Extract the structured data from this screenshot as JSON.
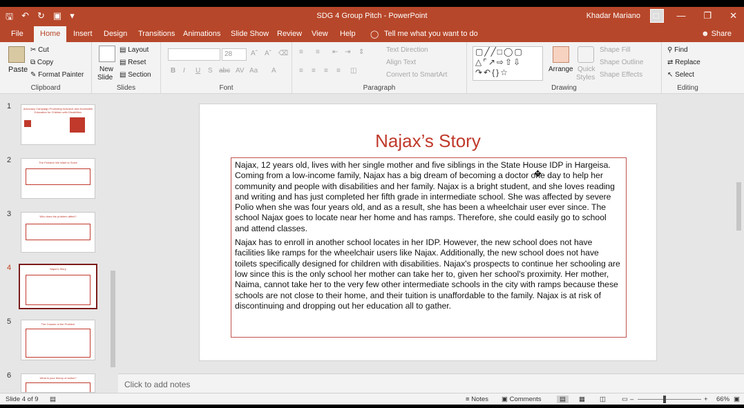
{
  "window": {
    "title": "SDG 4 Group Pitch - PowerPoint",
    "user": "Khadar Mariano"
  },
  "tabs": [
    "File",
    "Home",
    "Insert",
    "Design",
    "Transitions",
    "Animations",
    "Slide Show",
    "Review",
    "View",
    "Help"
  ],
  "tell_me": "Tell me what you want to do",
  "share": "Share",
  "ribbon": {
    "clipboard": {
      "paste": "Paste",
      "cut": "Cut",
      "copy": "Copy",
      "format_painter": "Format Painter",
      "label": "Clipboard"
    },
    "slides": {
      "new_slide_1": "New",
      "new_slide_2": "Slide",
      "layout": "Layout",
      "reset": "Reset",
      "section": "Section",
      "label": "Slides"
    },
    "font": {
      "size": "28",
      "label": "Font"
    },
    "paragraph": {
      "text_direction": "Text Direction",
      "align_text": "Align Text",
      "convert": "Convert to SmartArt",
      "label": "Paragraph"
    },
    "drawing": {
      "arrange": "Arrange",
      "quick_styles_1": "Quick",
      "quick_styles_2": "Styles",
      "shape_fill": "Shape Fill",
      "shape_outline": "Shape Outline",
      "shape_effects": "Shape Effects",
      "label": "Drawing"
    },
    "editing": {
      "find": "Find",
      "replace": "Replace",
      "select": "Select",
      "label": "Editing"
    }
  },
  "thumbnails": [
    {
      "num": "1",
      "title": "Advocacy Campaign Promoting Inclusive and Accessible Education for Children with Disabilities"
    },
    {
      "num": "2",
      "title": "The Problem We Want to Solve"
    },
    {
      "num": "3",
      "title": "Who does the problem affect?"
    },
    {
      "num": "4",
      "title": "Najax's Story"
    },
    {
      "num": "5",
      "title": "The Causes of the Problem"
    },
    {
      "num": "6",
      "title": "What is your theory of action?"
    }
  ],
  "slide": {
    "title": "Najax’s Story",
    "paragraphs": [
      "Najax, 12 years old, lives with her single mother and five siblings in the State House IDP in Hargeisa. Coming from a low-income family, Najax has a big dream of becoming a doctor one day to help her community and people with disabilities and her family. Najax is a bright student, and she loves reading and writing and has just completed her fifth grade in intermediate school.  She was affected by severe Polio when she was four years old, and as a result, she has been a wheelchair user ever since.  The school Najax goes to locate near her home and has ramps. Therefore, she could easily go to school and attend classes.",
      "Najax has to enroll in another school locates in her IDP. However, the new school does not have facilities like ramps for the wheelchair users like Najax. Additionally, the new school does not have toilets specifically designed for children with disabilities. Najax's prospects to continue her schooling are low since this is the only school her mother can take her to, given her school's proximity. Her mother, Naima, cannot take her to the very few other intermediate schools in the city with ramps because these schools are not close to their home, and their tuition is unaffordable to the family. Najax is at risk of discontinuing and dropping out her education all to gather."
    ]
  },
  "notes_placeholder": "Click to add notes",
  "status": {
    "slide_info": "Slide 4 of 9",
    "notes": "Notes",
    "comments": "Comments",
    "zoom": "66%"
  }
}
